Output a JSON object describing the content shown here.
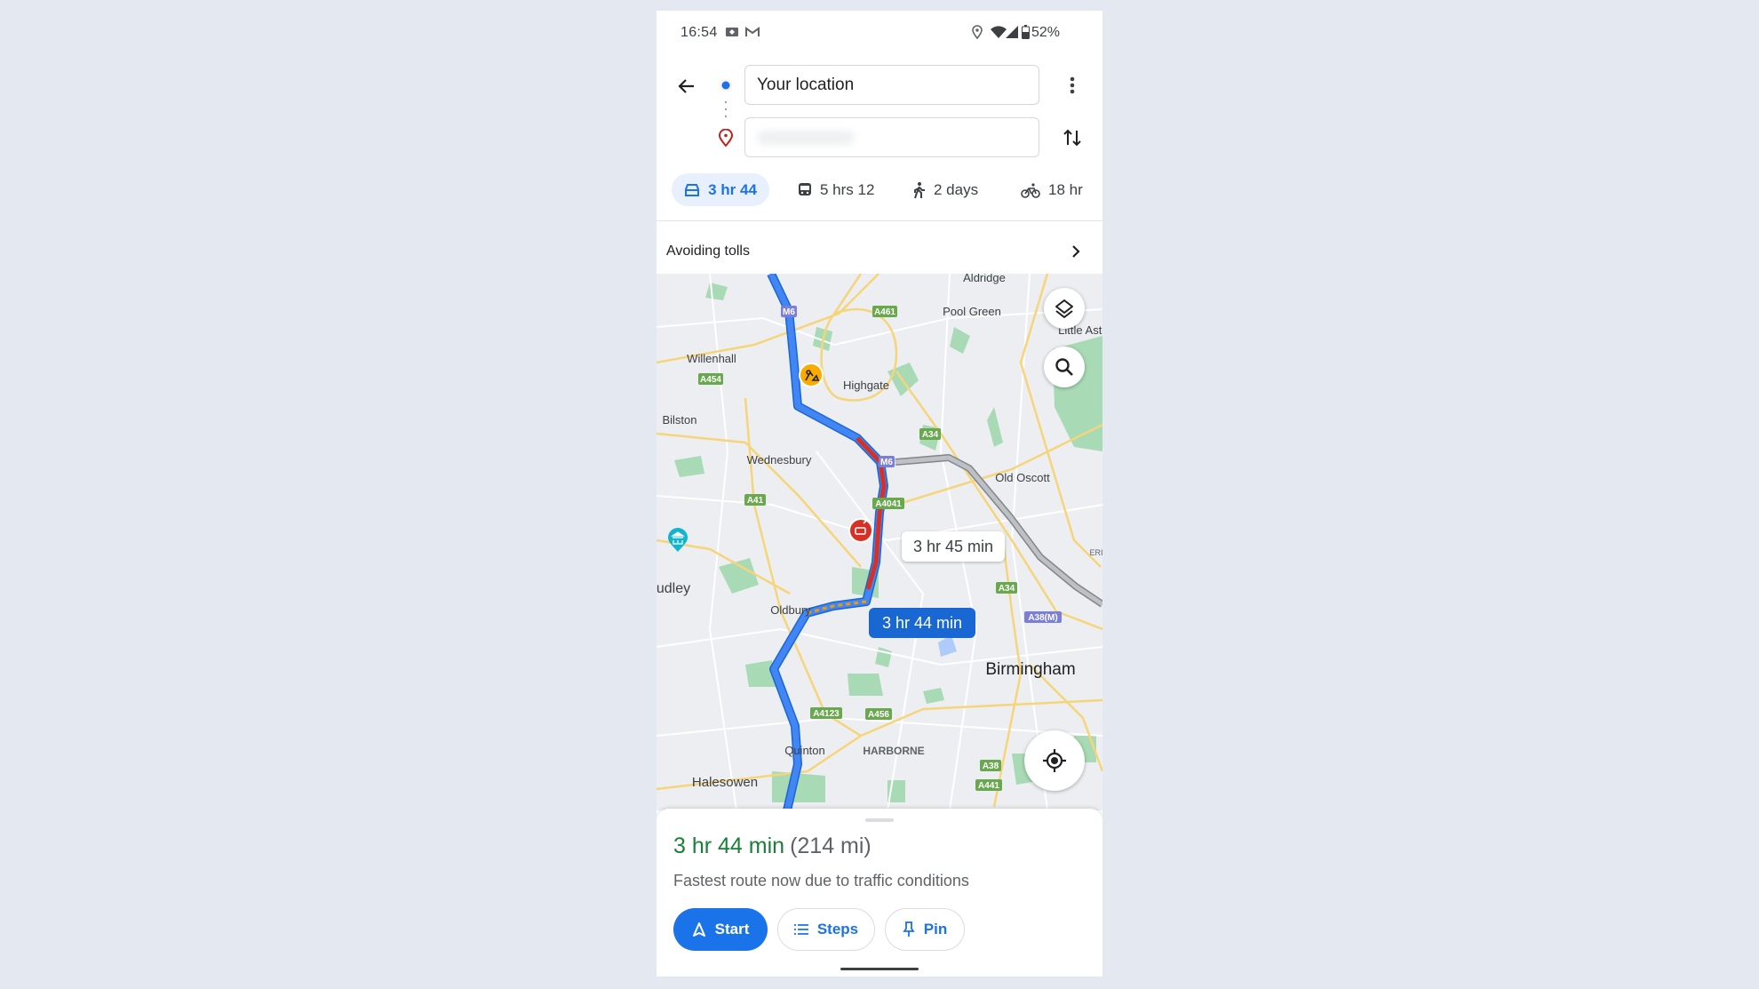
{
  "status_bar": {
    "time": "16:54",
    "battery": "52%"
  },
  "directions": {
    "origin_value": "Your location",
    "destination_value": "",
    "modes": [
      {
        "icon": "car-icon",
        "label": "3 hr 44",
        "selected": true
      },
      {
        "icon": "transit-icon",
        "label": "5 hrs 12",
        "selected": false
      },
      {
        "icon": "walk-icon",
        "label": "2 days",
        "selected": false
      },
      {
        "icon": "bike-icon",
        "label": "18 hr",
        "selected": false
      }
    ],
    "options_label": "Avoiding tolls"
  },
  "map": {
    "places": {
      "aldridge": "Aldridge",
      "pool_green": "Pool Green",
      "little_aston": "Little Astc",
      "willenhall": "Willenhall",
      "highgate": "Highgate",
      "bilston": "Bilston",
      "wednesbury": "Wednesbury",
      "old_oscott": "Old Oscott",
      "dudley": "udley",
      "oldbury": "Oldbury",
      "birmingham": "Birmingham",
      "quinton": "Quinton",
      "harborne": "HARBORNE",
      "halesowen": "Halesowen",
      "erdington": "ERI"
    },
    "roads": {
      "m6a": "M6",
      "a461": "A461",
      "a454": "A454",
      "a34a": "A34",
      "m6b": "M6",
      "a41": "A41",
      "a4041": "A4041",
      "a34b": "A34",
      "a38m": "A38(M)",
      "a4123": "A4123",
      "a456": "A456",
      "a38": "A38",
      "a441": "A441"
    },
    "route_labels": {
      "alternate": "3 hr 45 min",
      "selected": "3 hr 44 min"
    },
    "colors": {
      "route": "#4285f4",
      "traffic_heavy": "#d93025",
      "alternate": "#9aa0a6",
      "park": "#a8dab5"
    }
  },
  "summary": {
    "duration": "3 hr 44 min",
    "distance": "(214 mi)",
    "note": "Fastest route now due to traffic conditions",
    "start_label": "Start",
    "steps_label": "Steps",
    "pin_label": "Pin"
  },
  "colors": {
    "accent": "#1a73e8",
    "duration_green": "#188038"
  }
}
